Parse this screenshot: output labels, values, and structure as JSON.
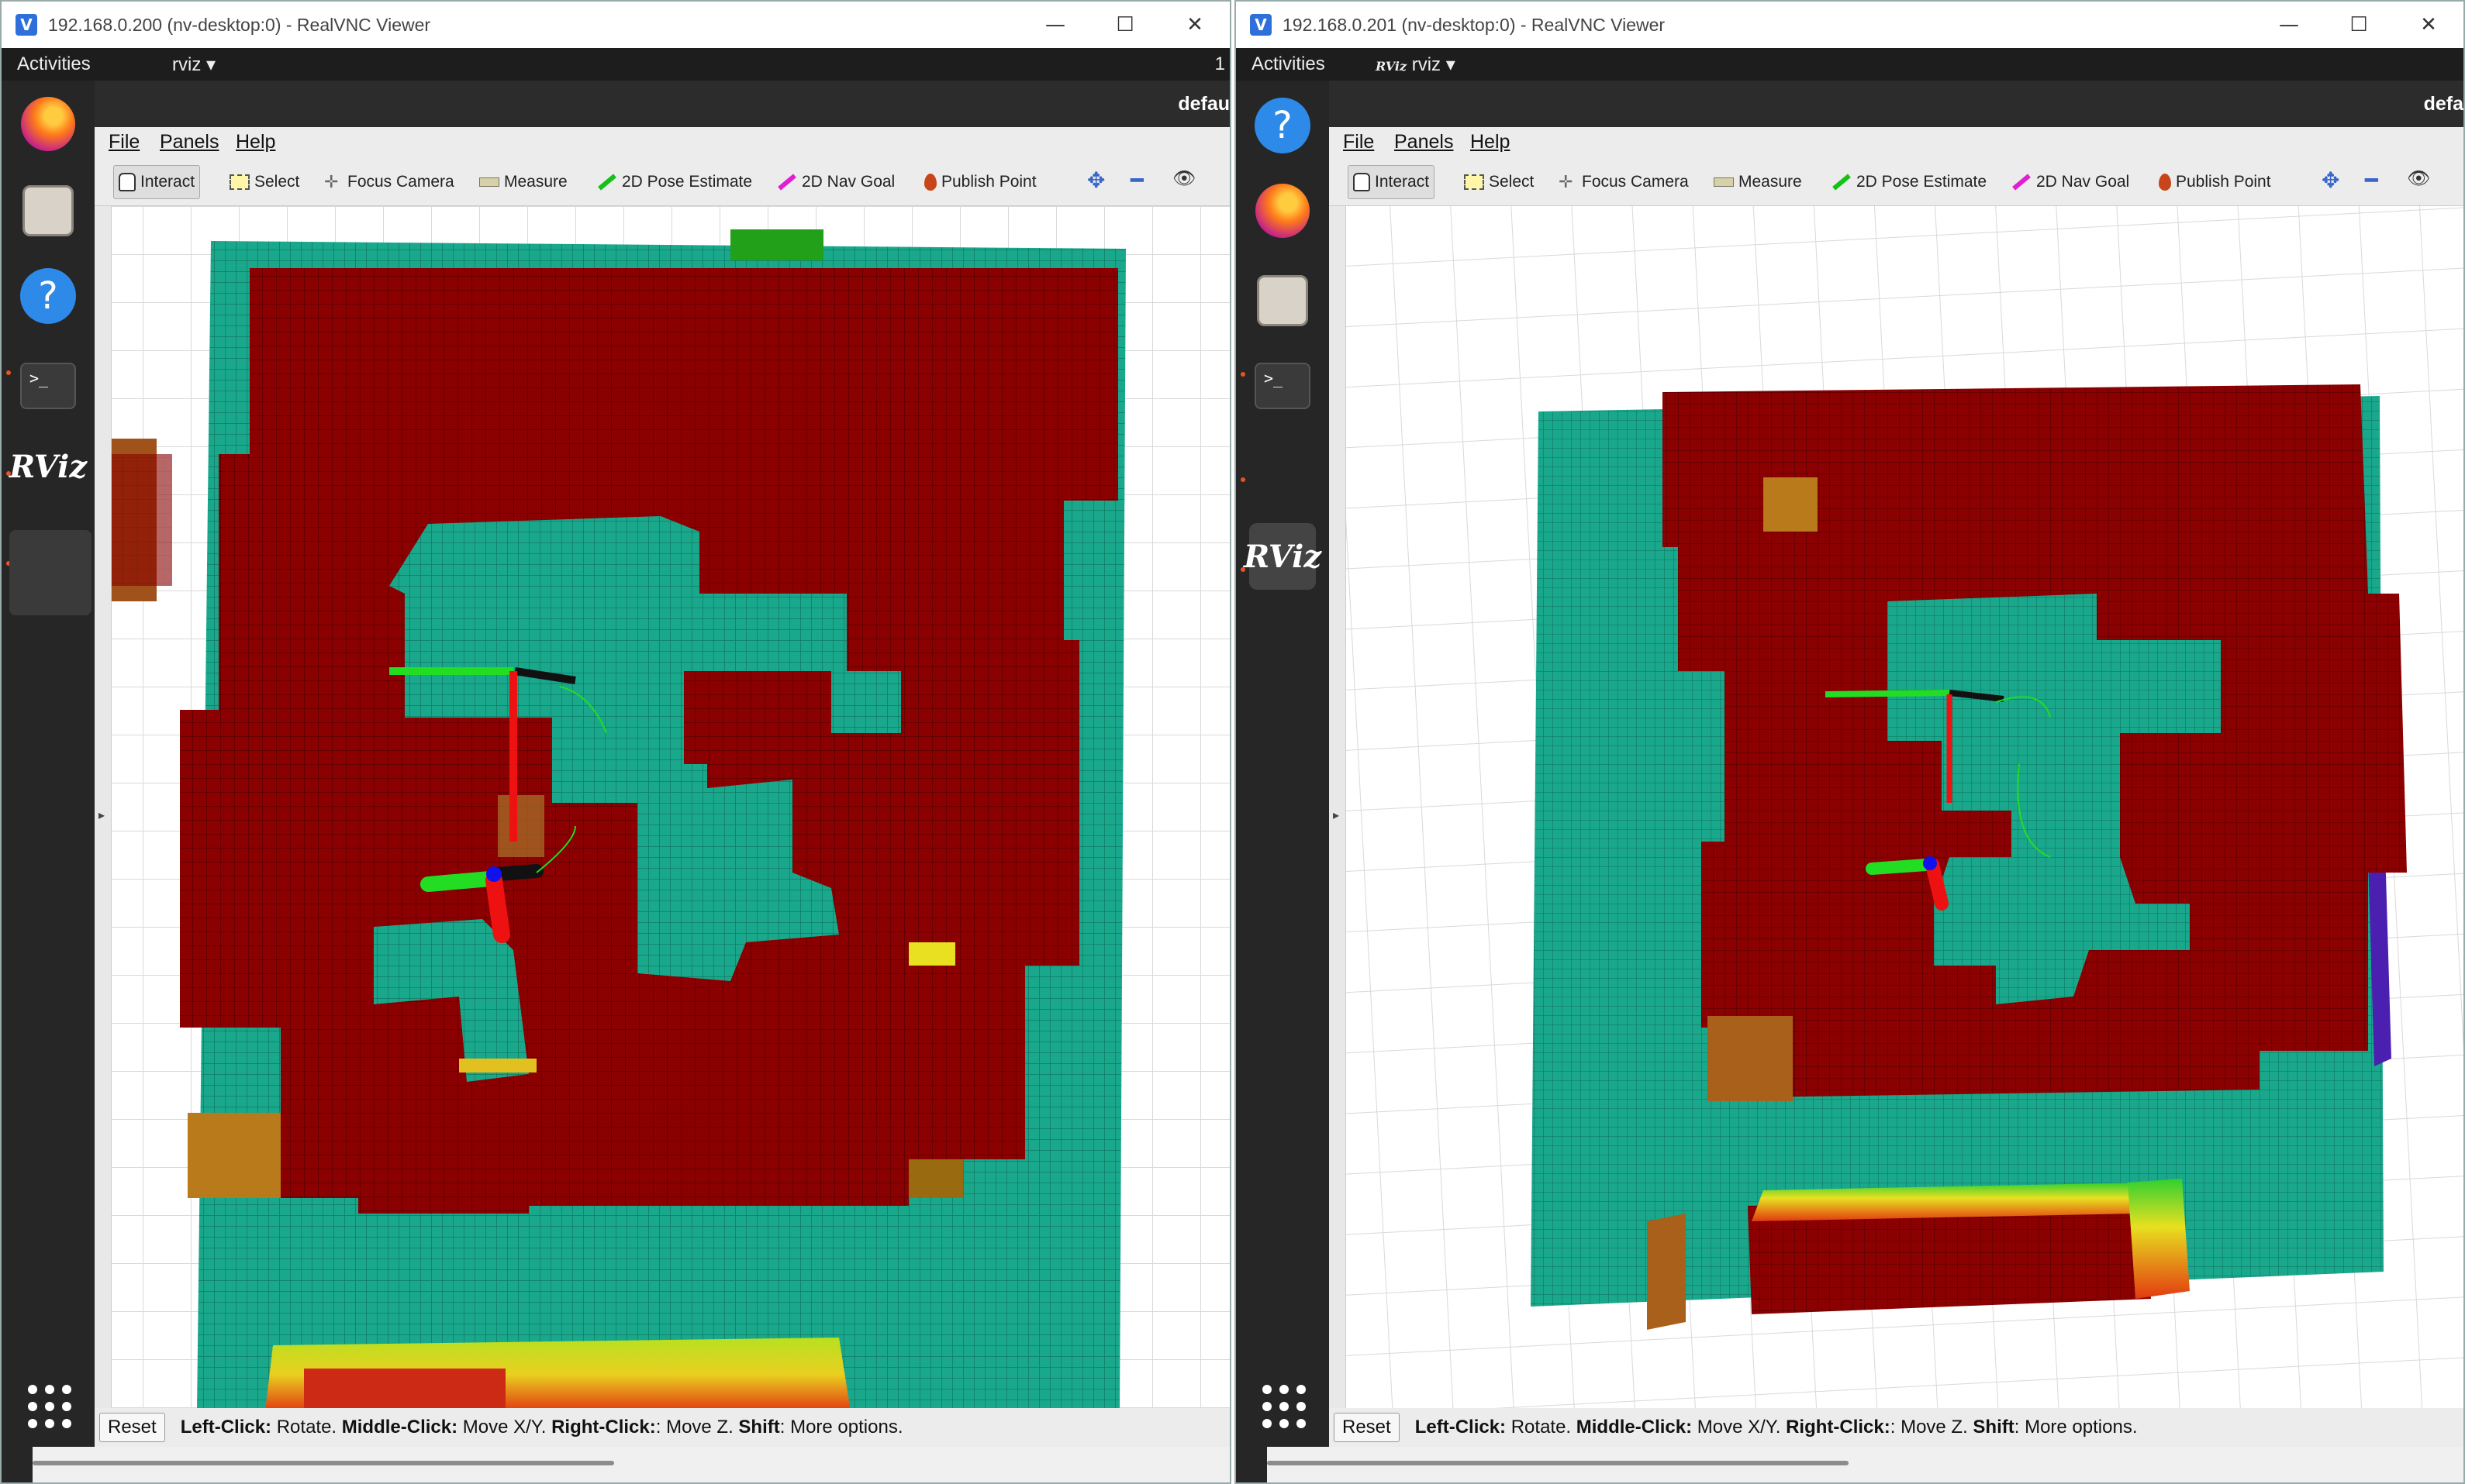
{
  "windows": [
    {
      "title": "192.168.0.200 (nv-desktop:0) - RealVNC Viewer",
      "topbar": {
        "activities": "Activities",
        "app": "rviz",
        "right_text": "1"
      },
      "header_text": "defau",
      "menu": [
        "File",
        "Panels",
        "Help"
      ],
      "tools": [
        "Interact",
        "Select",
        "Focus Camera",
        "Measure",
        "2D Pose Estimate",
        "2D Nav Goal",
        "Publish Point"
      ],
      "reset_label": "Reset",
      "status": {
        "k1": "Left-Click:",
        "v1": " Rotate. ",
        "k2": "Middle-Click:",
        "v2": " Move X/Y. ",
        "k3": "Right-Click:",
        "v3": ": Move Z. ",
        "k4": "Shift",
        "v4": ": More options."
      }
    },
    {
      "title": "192.168.0.201 (nv-desktop:0) - RealVNC Viewer",
      "topbar": {
        "activities": "Activities",
        "app": "rviz",
        "right_text": ""
      },
      "header_text": "defa",
      "menu": [
        "File",
        "Panels",
        "Help"
      ],
      "tools": [
        "Interact",
        "Select",
        "Focus Camera",
        "Measure",
        "2D Pose Estimate",
        "2D Nav Goal",
        "Publish Point"
      ],
      "reset_label": "Reset",
      "status": {
        "k1": "Left-Click:",
        "v1": " Rotate. ",
        "k2": "Middle-Click:",
        "v2": " Move X/Y. ",
        "k3": "Right-Click:",
        "v3": ": Move Z. ",
        "k4": "Shift",
        "v4": ": More options."
      }
    }
  ],
  "icons": {
    "window_controls": [
      "minimize-icon",
      "maximize-icon",
      "close-icon"
    ],
    "dock": [
      "firefox-icon",
      "files-icon",
      "help-icon",
      "terminal-icon",
      "rviz-icon",
      "show-apps-icon"
    ],
    "toolbar_extra": [
      "move-camera-icon",
      "zoom-out-icon",
      "visibility-eye-icon"
    ]
  },
  "colors": {
    "occupied_voxel": "#8b0000",
    "free_voxel": "#1aa88c",
    "grid": "#d9d9d9",
    "green_axis": "#22dd22",
    "red_axis": "#ee1111"
  },
  "glyphs": {
    "minimize": "—",
    "maximize": "☐",
    "close": "✕",
    "dropdown": "▾",
    "help": "?",
    "terminal": ">_",
    "rviz": "RViz",
    "collapse": "▸",
    "camera_move": "✥",
    "zoom_plus": "✚",
    "zoom_minus": "━",
    "eye": "👁",
    "focus": "✛"
  }
}
